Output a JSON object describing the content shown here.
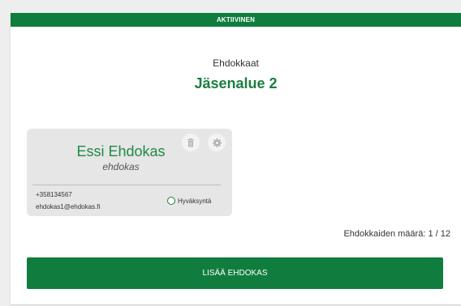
{
  "status": {
    "label": "AKTIIVINEN"
  },
  "header": {
    "subtitle": "Ehdokkaat",
    "title": "Jäsenalue 2"
  },
  "candidate": {
    "name": "Essi Ehdokas",
    "role": "ehdokas",
    "phone": "+358134567",
    "email": "ehdokas1@ehdokas.fi",
    "approve_label": "Hyväksyntä",
    "icons": {
      "delete": "trash-icon",
      "settings": "gear-icon"
    }
  },
  "count": {
    "label": "Ehdokkaiden määrä:",
    "current": "1",
    "total": "12"
  },
  "actions": {
    "add_label": "LISÄÄ EHDOKAS"
  },
  "colors": {
    "brand_green": "#0e7d3d",
    "name_green": "#1f8a45"
  }
}
